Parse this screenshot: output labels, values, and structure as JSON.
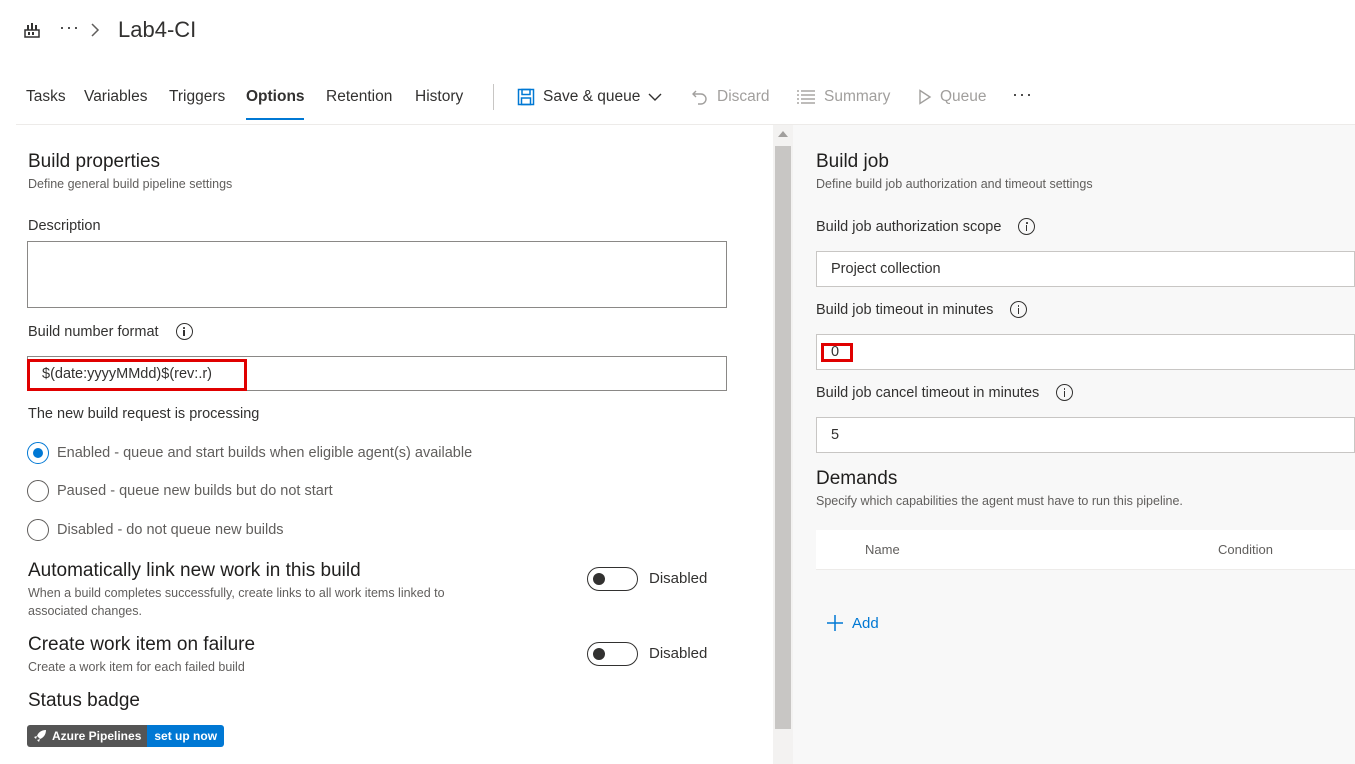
{
  "header": {
    "title": "Lab4-CI",
    "more": "···"
  },
  "tabs": [
    {
      "label": "Tasks"
    },
    {
      "label": "Variables"
    },
    {
      "label": "Triggers"
    },
    {
      "label": "Options"
    },
    {
      "label": "Retention"
    },
    {
      "label": "History"
    }
  ],
  "toolbar": {
    "save_queue": "Save & queue",
    "discard": "Discard",
    "summary": "Summary",
    "queue": "Queue",
    "more": "···"
  },
  "build_properties": {
    "title": "Build properties",
    "subtitle": "Define general build pipeline settings",
    "description_label": "Description",
    "description_value": "",
    "build_number_label": "Build number format",
    "build_number_value": "$(date:yyyyMMdd)$(rev:.r)",
    "processing_label": "The new build request is processing",
    "radio_options": [
      {
        "label": "Enabled - queue and start builds when eligible agent(s) available",
        "checked": true
      },
      {
        "label": "Paused - queue new builds but do not start",
        "checked": false
      },
      {
        "label": "Disabled - do not queue new builds",
        "checked": false
      }
    ],
    "auto_link": {
      "title": "Automatically link new work in this build",
      "desc_line1": "When a build completes successfully, create links to all work items linked to",
      "desc_line2": "associated changes.",
      "state": "Disabled"
    },
    "work_item": {
      "title": "Create work item on failure",
      "desc": "Create a work item for each failed build",
      "state": "Disabled"
    },
    "status_badge": {
      "title": "Status badge",
      "badge_left": "Azure Pipelines",
      "badge_right": "set up now"
    }
  },
  "build_job": {
    "title": "Build job",
    "subtitle": "Define build job authorization and timeout settings",
    "auth_scope_label": "Build job authorization scope",
    "auth_scope_value": "Project collection",
    "timeout_label": "Build job timeout in minutes",
    "timeout_value": "0",
    "cancel_timeout_label": "Build job cancel timeout in minutes",
    "cancel_timeout_value": "5"
  },
  "demands": {
    "title": "Demands",
    "subtitle": "Specify which capabilities the agent must have to run this pipeline.",
    "columns": [
      "Name",
      "Condition"
    ],
    "add_label": "Add"
  },
  "colors": {
    "accent": "#0078d4",
    "highlight": "#e00000"
  }
}
